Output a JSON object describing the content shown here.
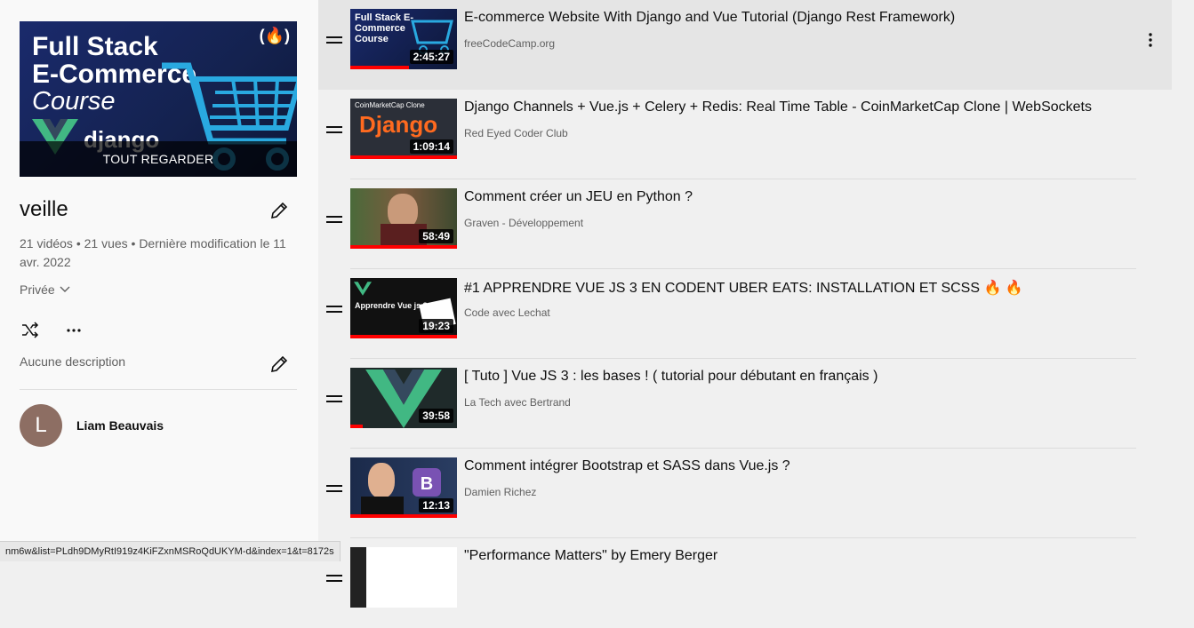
{
  "playlist": {
    "hero": {
      "line1": "Full Stack",
      "line2": "E-Commerce",
      "line3": "Course",
      "brand": "django",
      "overlay_label": "TOUT REGARDER"
    },
    "title": "veille",
    "meta": "21 vidéos • 21 vues • Dernière modification le 11 avr. 2022",
    "privacy": "Privée",
    "description": "Aucune description",
    "owner": {
      "initial": "L",
      "name": "Liam Beauvais",
      "avatar_color": "#8d6e63"
    }
  },
  "videos": [
    {
      "title": "E-commerce Website With Django and Vue Tutorial (Django Rest Framework)",
      "channel": "freeCodeCamp.org",
      "duration": "2:45:27",
      "thumb_text": "Full Stack E-Commerce Course",
      "progress": 0.55
    },
    {
      "title": "Django Channels + Vue.js + Celery + Redis: Real Time Table - CoinMarketCap Clone | WebSockets",
      "channel": "Red Eyed Coder Club",
      "duration": "1:09:14",
      "thumb_text": "Django",
      "thumb_sub": "CoinMarketCap Clone",
      "progress": 1.0
    },
    {
      "title": "Comment créer un JEU en Python ?",
      "channel": "Graven - Développement",
      "duration": "58:49",
      "progress": 1.0
    },
    {
      "title": "#1 APPRENDRE VUE JS 3 EN CODENT UBER EATS: INSTALLATION ET SCSS 🔥 🔥",
      "channel": "Code avec Lechat",
      "duration": "19:23",
      "thumb_text": "Apprendre Vue js 3",
      "progress": 1.0
    },
    {
      "title": "[ Tuto ] Vue JS 3 : les bases ! ( tutorial pour débutant en français )",
      "channel": "La Tech avec Bertrand",
      "duration": "39:58",
      "progress": 0.12
    },
    {
      "title": "Comment intégrer Bootstrap et SASS dans Vue.js ?",
      "channel": "Damien Richez",
      "duration": "12:13",
      "progress": 1.0
    },
    {
      "title": "\"Performance Matters\" by Emery Berger",
      "channel": "",
      "duration": "",
      "progress": 0
    }
  ],
  "status_url": "nm6w&list=PLdh9DMyRtI919z4KiFZxnMSRoQdUKYM-d&index=1&t=8172s",
  "colors": {
    "progress": "#ff0000",
    "accent": "#0f0f0f",
    "muted": "#606060"
  }
}
